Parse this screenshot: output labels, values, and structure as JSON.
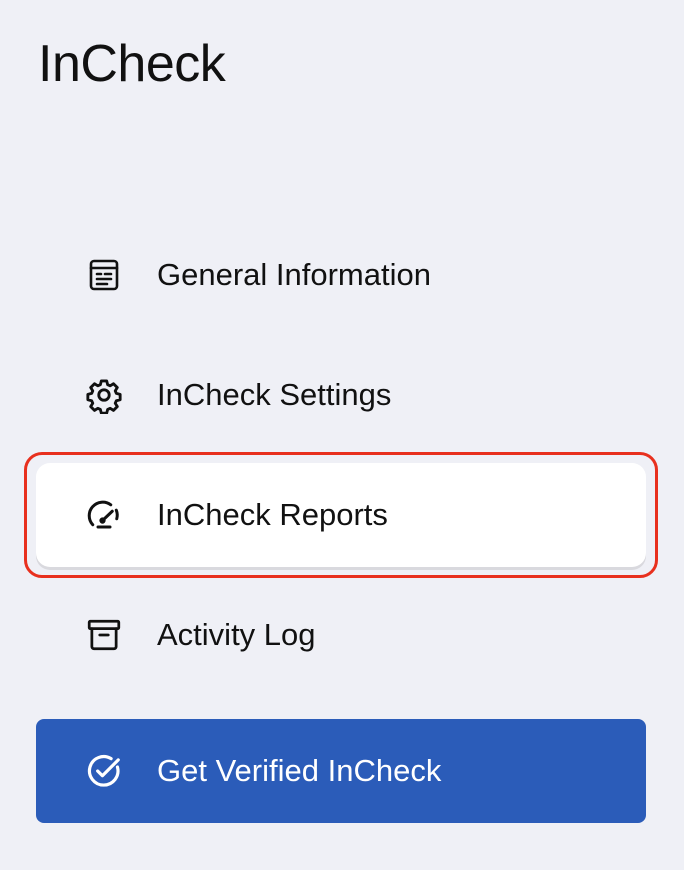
{
  "app": {
    "title": "InCheck"
  },
  "nav": {
    "items": [
      {
        "label": "General Information",
        "icon": "document-list-icon",
        "selected": false
      },
      {
        "label": "InCheck Settings",
        "icon": "gear-icon",
        "selected": false
      },
      {
        "label": "InCheck Reports",
        "icon": "speedometer-icon",
        "selected": true
      },
      {
        "label": "Activity Log",
        "icon": "archive-box-icon",
        "selected": false
      }
    ],
    "cta": {
      "label": "Get Verified InCheck",
      "icon": "check-circle-icon"
    }
  },
  "colors": {
    "background": "#eff0f6",
    "selected_item_bg": "#ffffff",
    "highlight_border": "#e8301e",
    "cta_bg": "#2b5cb9",
    "cta_text": "#ffffff",
    "text": "#111111"
  }
}
